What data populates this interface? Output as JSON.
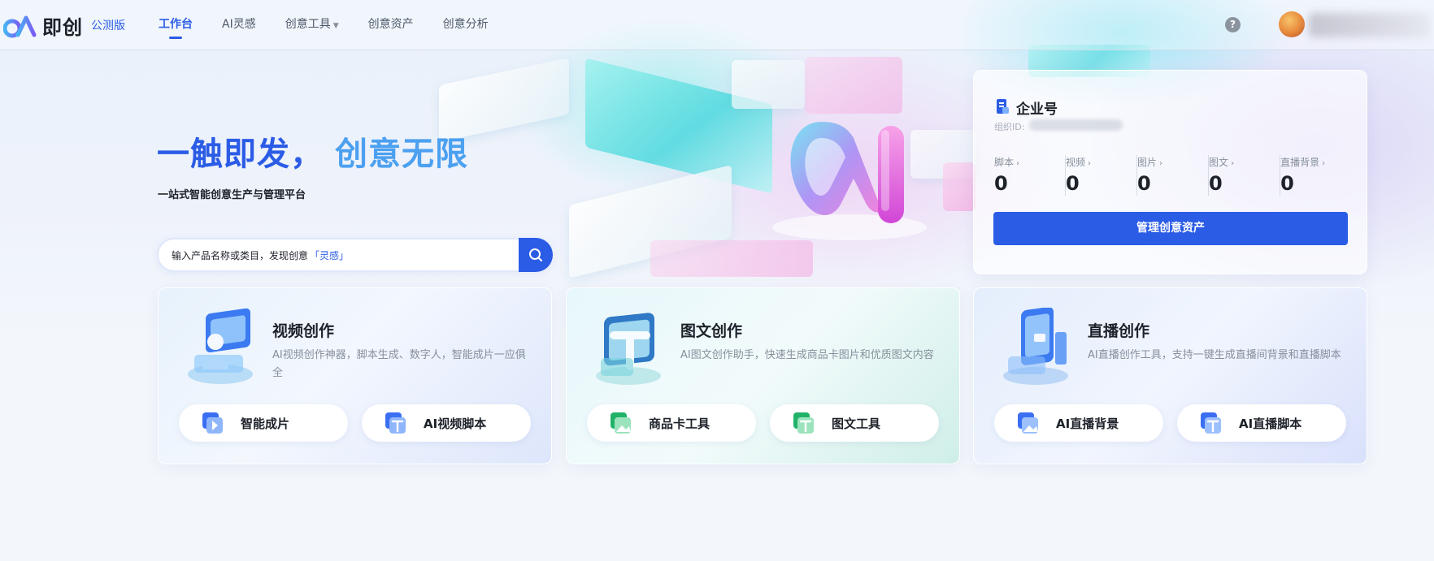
{
  "app": {
    "name": "即创",
    "badge": "公测版"
  },
  "nav": {
    "items": [
      {
        "label": "工作台",
        "active": true
      },
      {
        "label": "AI灵感"
      },
      {
        "label": "创意工具",
        "has_dropdown": true
      },
      {
        "label": "创意资产"
      },
      {
        "label": "创意分析"
      }
    ],
    "help_glyph": "?"
  },
  "hero": {
    "title_part1": "一触即发，",
    "title_part2": "创意无限",
    "subtitle": "一站式智能创意生产与管理平台"
  },
  "search": {
    "placeholder_prefix": "输入产品名称或类目，发现创意",
    "placeholder_highlight": "「灵感」"
  },
  "enterprise": {
    "title": "企业号",
    "org_id_label": "组织ID:",
    "stats": [
      {
        "label": "脚本",
        "value": "0"
      },
      {
        "label": "视频",
        "value": "0"
      },
      {
        "label": "图片",
        "value": "0"
      },
      {
        "label": "图文",
        "value": "0"
      },
      {
        "label": "直播背景",
        "value": "0"
      }
    ],
    "manage_button": "管理创意资产"
  },
  "features": [
    {
      "title": "视频创作",
      "desc": "AI视频创作神器，脚本生成、数字人，智能成片一应俱全",
      "buttons": [
        {
          "label": "智能成片"
        },
        {
          "label": "AI视频脚本"
        }
      ]
    },
    {
      "title": "图文创作",
      "desc": "AI图文创作助手，快速生成商品卡图片和优质图文内容",
      "buttons": [
        {
          "label": "商品卡工具"
        },
        {
          "label": "图文工具"
        }
      ]
    },
    {
      "title": "直播创作",
      "desc": "AI直播创作工具，支持一键生成直播间背景和直播脚本",
      "buttons": [
        {
          "label": "AI直播背景"
        },
        {
          "label": "AI直播脚本"
        }
      ]
    }
  ],
  "colors": {
    "primary": "#2b5ce6",
    "title_light": "#4ca0f0",
    "text_secondary": "#86909c"
  }
}
